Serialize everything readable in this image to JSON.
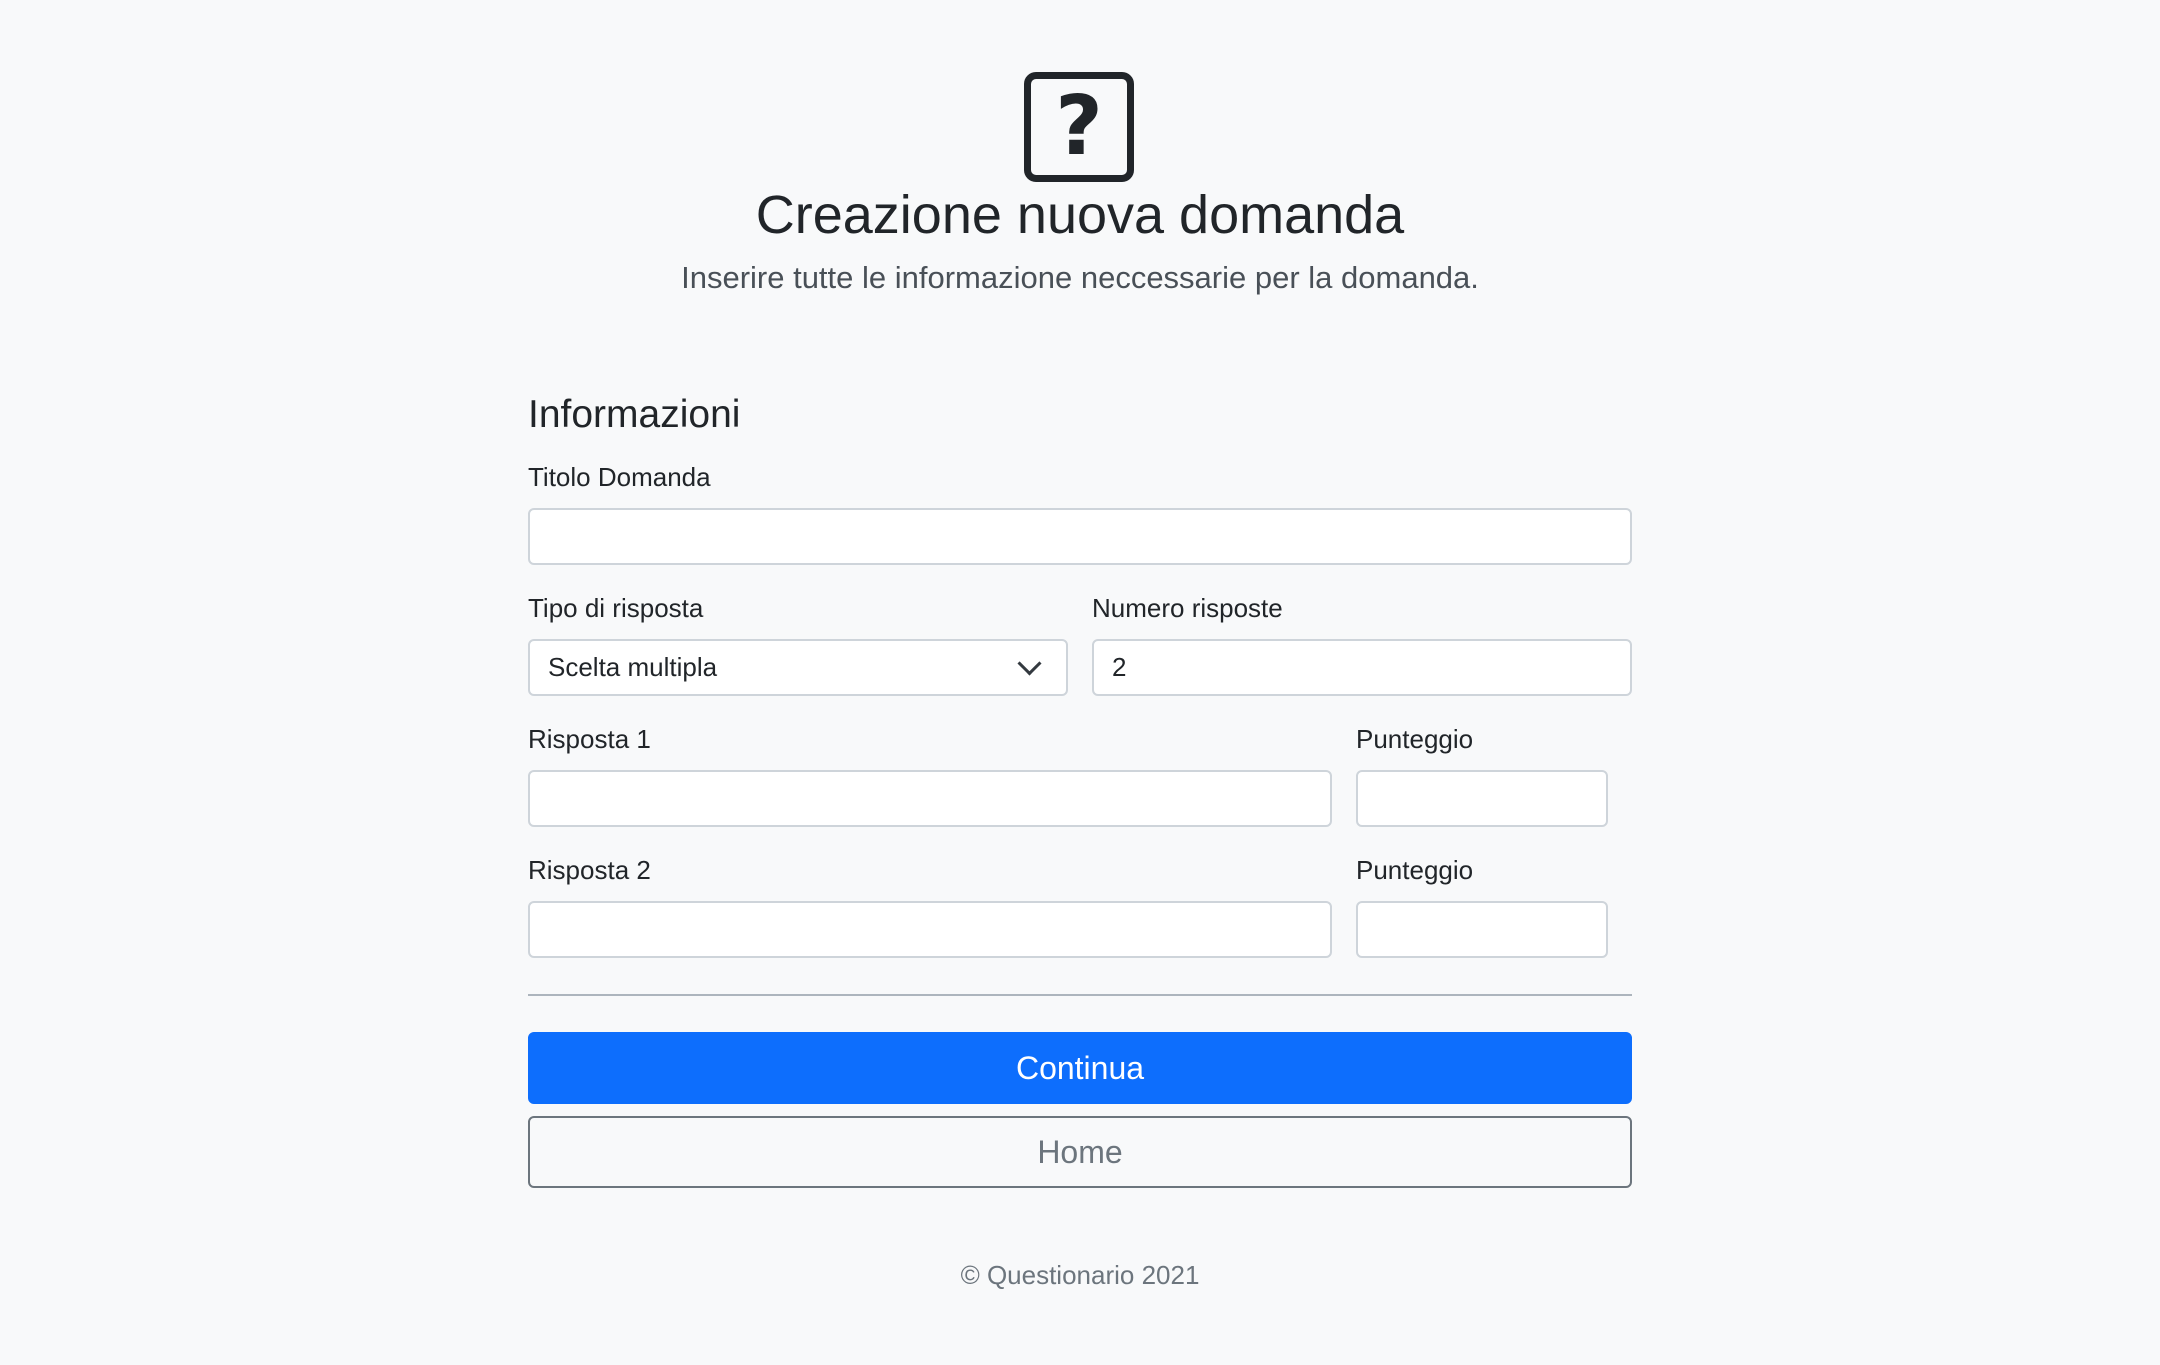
{
  "header": {
    "icon": "question-square-icon",
    "icon_glyph": "?",
    "title": "Creazione nuova domanda",
    "subtitle": "Inserire tutte le informazione neccessarie per la domanda."
  },
  "form": {
    "section_title": "Informazioni",
    "title_field": {
      "label": "Titolo Domanda",
      "value": ""
    },
    "answer_type": {
      "label": "Tipo di risposta",
      "selected": "Scelta multipla"
    },
    "answer_count": {
      "label": "Numero risposte",
      "value": "2"
    },
    "answers": [
      {
        "label": "Risposta 1",
        "value": "",
        "score_label": "Punteggio",
        "score": ""
      },
      {
        "label": "Risposta 2",
        "value": "",
        "score_label": "Punteggio",
        "score": ""
      }
    ]
  },
  "actions": {
    "continue_label": "Continua",
    "home_label": "Home"
  },
  "footer": {
    "text": "© Questionario 2021"
  },
  "colors": {
    "background": "#f8f9fa",
    "primary": "#0d6efd",
    "secondary": "#6c757d",
    "text": "#212529"
  }
}
